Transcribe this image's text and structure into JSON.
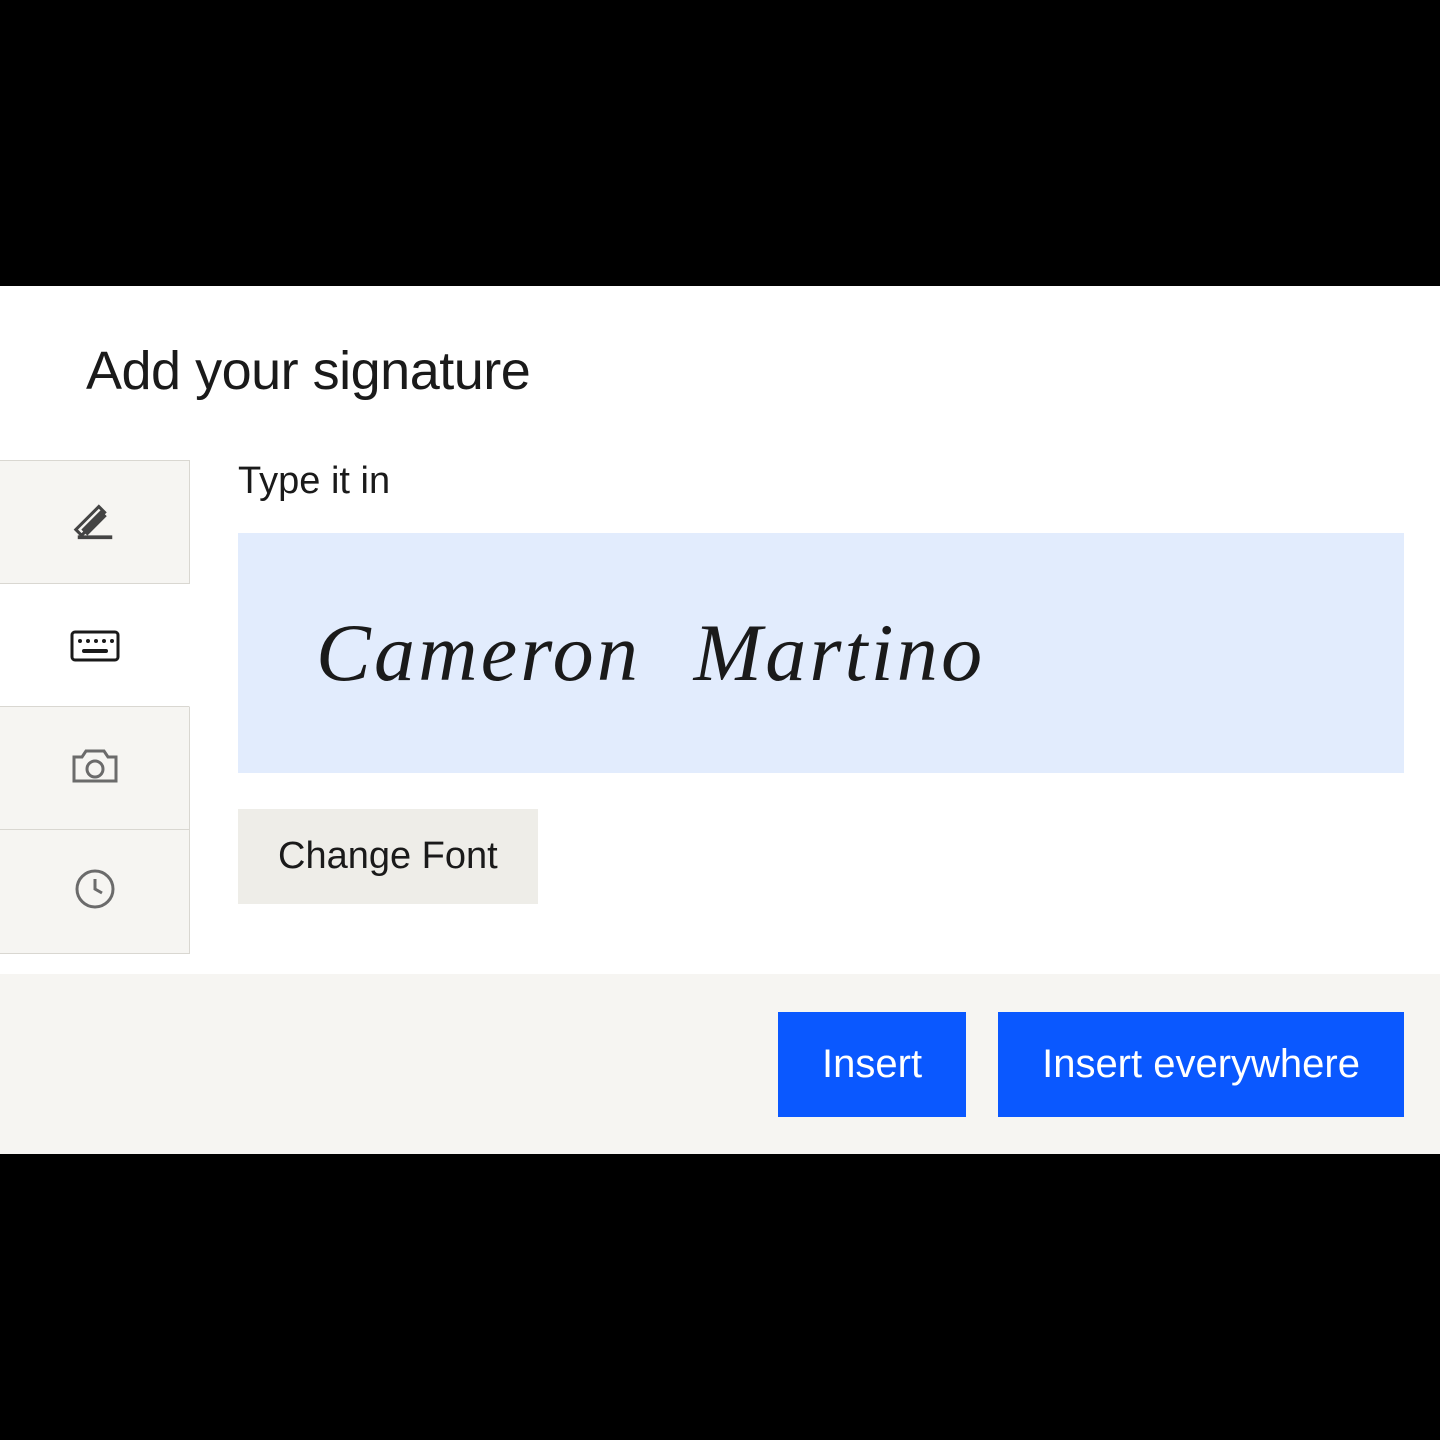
{
  "dialog": {
    "title": "Add your signature"
  },
  "sidebar": {
    "items": [
      {
        "name": "draw",
        "icon": "pen-icon"
      },
      {
        "name": "type",
        "icon": "keyboard-icon"
      },
      {
        "name": "photo",
        "icon": "camera-icon"
      },
      {
        "name": "recent",
        "icon": "clock-icon"
      }
    ],
    "active_index": 1
  },
  "type_tab": {
    "heading": "Type it in",
    "signature_value": "Cameron Martino",
    "change_font_label": "Change Font"
  },
  "footer": {
    "insert_label": "Insert",
    "insert_everywhere_label": "Insert everywhere"
  },
  "colors": {
    "accent": "#0a58ff",
    "input_bg": "#e2ecfd",
    "panel_bg": "#f6f5f2"
  }
}
